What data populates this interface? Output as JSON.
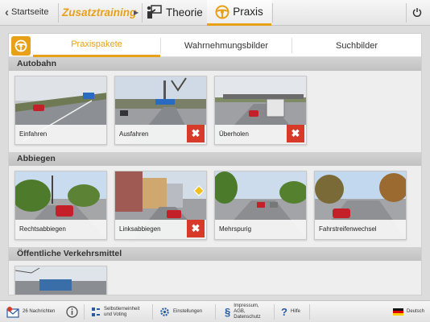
{
  "topbar": {
    "back_label": "Startseite",
    "zusatz_label": "Zusatztraining",
    "theorie_label": "Theorie",
    "praxis_label": "Praxis"
  },
  "subtabs": [
    "Praxispakete",
    "Wahrnehmungsbilder",
    "Suchbilder"
  ],
  "sections": [
    {
      "title": "Autobahn",
      "tiles": [
        {
          "label": "Einfahren",
          "deletable": false
        },
        {
          "label": "Ausfahren",
          "deletable": true
        },
        {
          "label": "Überholen",
          "deletable": true
        }
      ]
    },
    {
      "title": "Abbiegen",
      "tiles": [
        {
          "label": "Rechtsabbiegen",
          "deletable": false
        },
        {
          "label": "Linksabbiegen",
          "deletable": true
        },
        {
          "label": "Mehrspurig",
          "deletable": false
        },
        {
          "label": "Fahrstreifenwechsel",
          "deletable": false
        }
      ]
    },
    {
      "title": "Öffentliche Verkehrsmittel",
      "tiles": [
        {
          "label": "",
          "deletable": false
        }
      ]
    }
  ],
  "bottombar": {
    "messages": "26 Nachrichten",
    "selbst_line1": "Selbstlerneinheit",
    "selbst_line2": "und Voting",
    "settings": "Einstellungen",
    "impressum_line1": "Impressum,",
    "impressum_line2": "AGB,",
    "impressum_line3": "Datenschutz",
    "help": "Hilfe",
    "language": "Deutsch"
  },
  "colors": {
    "accent": "#e8a018",
    "delete": "#d83a2a"
  }
}
